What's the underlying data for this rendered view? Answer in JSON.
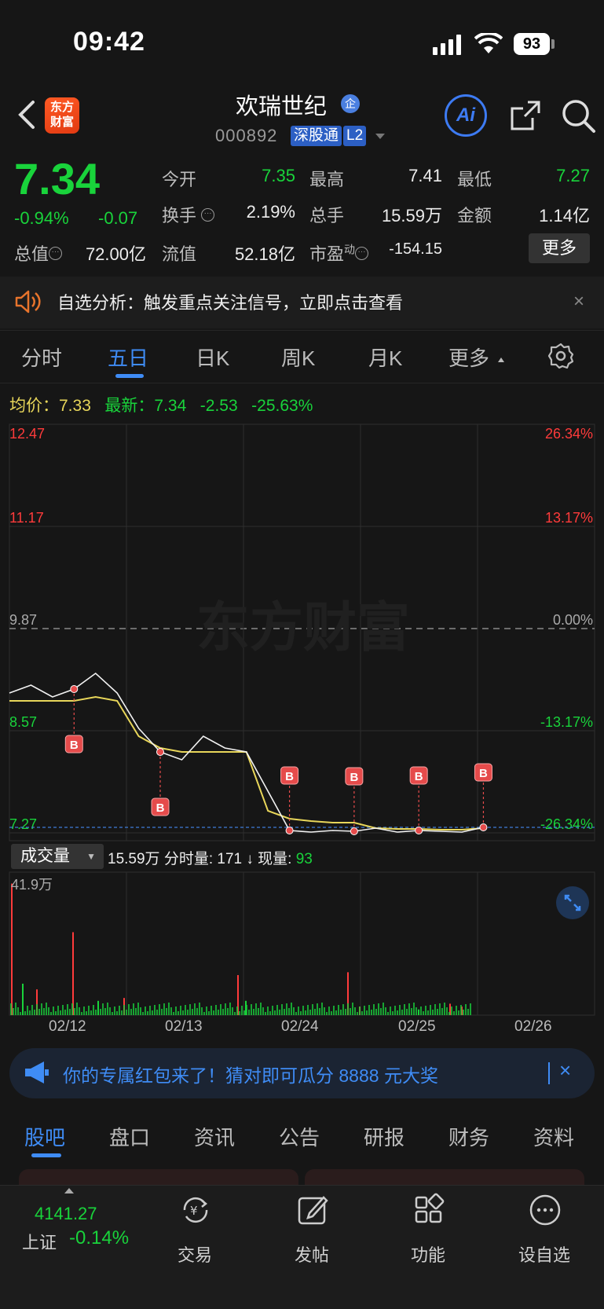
{
  "status_bar": {
    "time": "09:42",
    "battery": "93"
  },
  "header": {
    "logo_text_1": "东方",
    "logo_text_2": "财富",
    "stock_name": "欢瑞世纪",
    "badge": "企",
    "stock_code": "000892",
    "tag_connect": "深股通",
    "tag_level": "L2",
    "ai_label": "Ai"
  },
  "quote": {
    "price": "7.34",
    "change_pct": "-0.94%",
    "change_abs": "-0.07",
    "open_label": "今开",
    "open_value": "7.35",
    "high_label": "最高",
    "high_value": "7.41",
    "low_label": "最低",
    "low_value": "7.27",
    "turnover_label": "换手",
    "turnover_value": "2.19%",
    "volume_label": "总手",
    "volume_value": "15.59万",
    "amount_label": "金额",
    "amount_value": "1.14亿",
    "mktcap_label": "总值",
    "mktcap_value": "72.00亿",
    "float_label": "流值",
    "float_value": "52.18亿",
    "pe_label": "市盈",
    "pe_sup": "动",
    "pe_value": "-154.15",
    "more_label": "更多"
  },
  "alert": {
    "text": "自选分析：触发重点关注信号，立即点击查看",
    "close": "×"
  },
  "chart_tabs": [
    {
      "label": "分时"
    },
    {
      "label": "五日"
    },
    {
      "label": "日K"
    },
    {
      "label": "周K"
    },
    {
      "label": "月K"
    },
    {
      "label": "更多"
    }
  ],
  "chart_info": {
    "avg_label": "均价：",
    "avg_value": "7.33",
    "latest_label": "最新：",
    "latest_value": "7.34",
    "chg_abs": "-2.53",
    "chg_pct": "-25.63%"
  },
  "chart_data": {
    "type": "line",
    "title": "",
    "y_left_ticks": [
      "12.47",
      "11.17",
      "9.87",
      "8.57",
      "7.27"
    ],
    "y_right_ticks": [
      "26.34%",
      "13.17%",
      "0.00%",
      "-13.17%",
      "-26.34%"
    ],
    "ylim": [
      7.27,
      12.47
    ],
    "prev_close": 9.87,
    "x_categories": [
      "02/12",
      "02/13",
      "02/24",
      "02/25",
      "02/26"
    ],
    "series": [
      {
        "values": [
          9.05,
          9.15,
          9.0,
          9.1,
          9.3,
          9.05,
          8.6,
          8.3,
          8.2,
          8.5,
          8.35,
          8.3,
          7.8,
          7.3,
          7.28,
          7.3,
          7.29,
          7.33,
          7.28,
          7.3,
          7.29,
          7.28,
          7.34
        ]
      },
      {
        "values": [
          8.95,
          8.95,
          8.95,
          8.95,
          9.0,
          8.95,
          8.5,
          8.35,
          8.3,
          8.3,
          8.3,
          8.3,
          7.55,
          7.45,
          7.42,
          7.4,
          7.4,
          7.33,
          7.32,
          7.32,
          7.31,
          7.31,
          7.33
        ]
      }
    ],
    "buy_markers": [
      "B",
      "B",
      "B",
      "B",
      "B",
      "B"
    ],
    "volume": {
      "label": "成交量",
      "max_label": "41.9万",
      "total": "15.59万",
      "tick_label": "分时量:",
      "tick_value": "171",
      "current_label": "现量:",
      "current_value": "93"
    }
  },
  "promo": {
    "text": "你的专属红包来了！猜对即可瓜分 8888 元大奖",
    "close": "×"
  },
  "bottom_tabs": [
    {
      "label": "股吧"
    },
    {
      "label": "盘口"
    },
    {
      "label": "资讯"
    },
    {
      "label": "公告"
    },
    {
      "label": "研报"
    },
    {
      "label": "财务"
    },
    {
      "label": "资料"
    }
  ],
  "bottom_nav": {
    "index_value": "4141.27",
    "index_name": "上证",
    "index_change": "-0.14%",
    "items": [
      {
        "label": "交易"
      },
      {
        "label": "发帖"
      },
      {
        "label": "功能"
      },
      {
        "label": "设自选"
      }
    ]
  },
  "colors": {
    "accent": "#3f8cf5",
    "up": "#ff3b3b",
    "down": "#19d33b",
    "avg_line": "#e8d65a"
  }
}
